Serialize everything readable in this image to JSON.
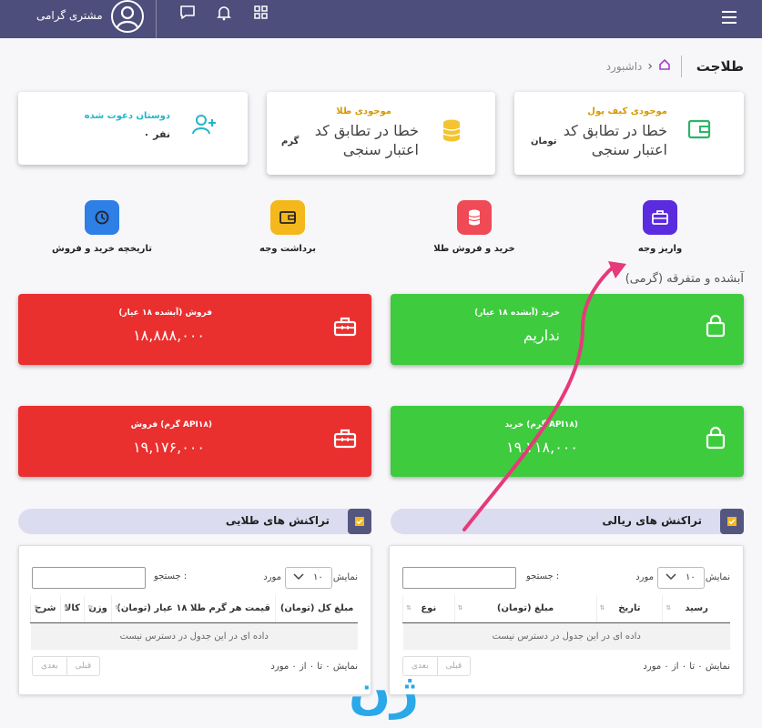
{
  "topbar": {
    "user_name": "مشتری گرامی"
  },
  "header": {
    "brand": "طلاجت",
    "breadcrumb": "داشبورد"
  },
  "cards": {
    "wallet": {
      "title": "موجودی کیف پول",
      "value_line1": "خطا در تطابق کد",
      "value_line2": "اعتبار سنجی",
      "unit": "تومان"
    },
    "gold": {
      "title": "موجودی طلا",
      "value_line1": "خطا در تطابق کد",
      "value_line2": "اعتبار سنجی",
      "unit": "گرم"
    },
    "invites": {
      "title": "دوستان دعوت شده",
      "value": "۰ نفر"
    }
  },
  "quick_actions": [
    {
      "label": "واریز وجه",
      "color": "#5b2be0",
      "icon": "briefcase-icon"
    },
    {
      "label": "خرید و فروش طلا",
      "color": "#ef4a55",
      "icon": "database-icon"
    },
    {
      "label": "برداشت وجه",
      "color": "#f4b81c",
      "icon": "wallet-icon"
    },
    {
      "label": "تاریخچه خرید و فروش",
      "color": "#2e7fe6",
      "icon": "history-icon"
    }
  ],
  "price_section": {
    "title": "آبشده و متفرقه (گرمی)"
  },
  "tiles": {
    "buy_abshode": {
      "title": "خرید (آبشده ۱۸ عیار)",
      "value": "نداریم"
    },
    "sell_abshode": {
      "title": "فروش (آبشده ۱۸ عیار)",
      "value": "۱۸,۸۸۸,۰۰۰"
    },
    "buy_gram": {
      "title": "خرید (گرم API۱۸)",
      "value": "۱۹,۲۱۸,۰۰۰"
    },
    "sell_gram": {
      "title": "فروش (گرم API۱۸)",
      "value": "۱۹,۱۷۶,۰۰۰"
    }
  },
  "colors": {
    "green": "#3ecb3e",
    "red": "#ea2f2f",
    "topbar": "#4d4e7b",
    "arrow": "#e63a7a"
  },
  "rial_table": {
    "title": "تراکنش های ریالی",
    "show_label": "نمایش",
    "page_size": "۱۰",
    "items_label": "مورد",
    "search_label": "جستجو :",
    "columns": [
      "نوع",
      "مبلغ (تومان)",
      "تاریخ",
      "رسید"
    ],
    "empty": "داده ای در این جدول در دسترس نیست",
    "info": "نمایش ۰ تا ۰ از ۰ مورد",
    "prev": "قبلی",
    "next": "بعدی"
  },
  "gold_table": {
    "title": "تراکنش های طلایی",
    "show_label": "نمایش",
    "page_size": "۱۰",
    "items_label": "مورد",
    "search_label": "جستجو :",
    "columns": [
      "شرح",
      "کالا",
      "وزن",
      "قیمت هر گرم طلا ۱۸ عیار (تومان)",
      "مبلغ کل (تومان)"
    ],
    "empty": "داده ای در این جدول در دسترس نیست",
    "info": "نمایش ۰ تا ۰ از ۰ مورد",
    "prev": "قبلی",
    "next": "بعدی"
  }
}
